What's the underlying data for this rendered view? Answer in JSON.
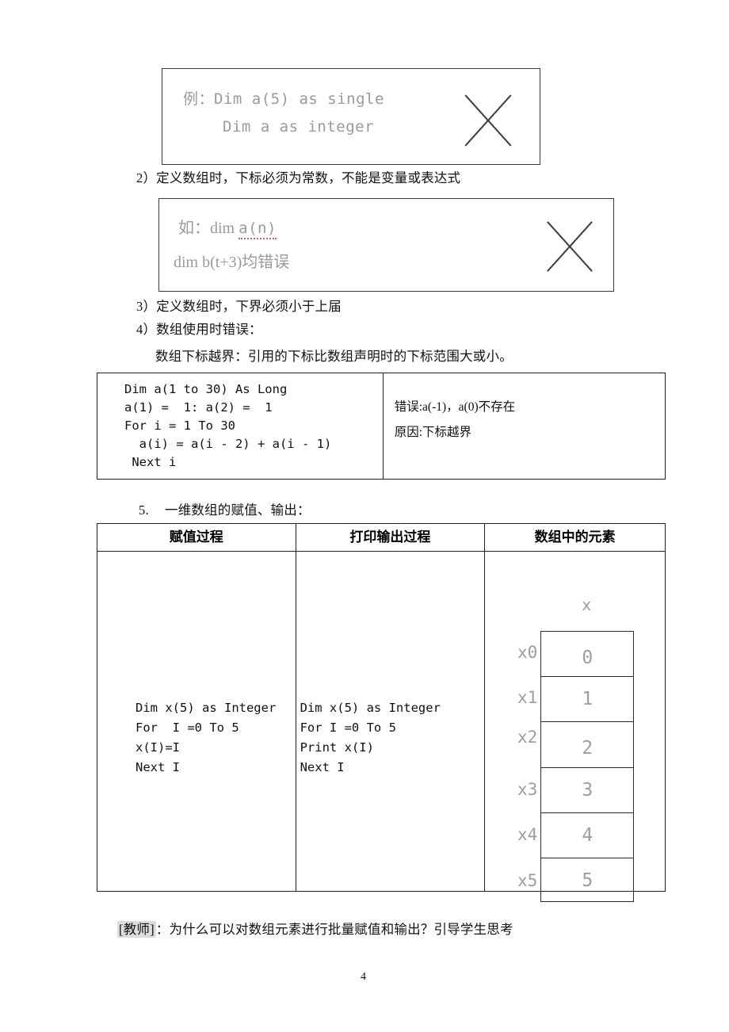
{
  "page": {
    "number": "4",
    "background": "#ffffff"
  },
  "example_box_1": {
    "lines": [
      "例：Dim a(5) as single",
      "Dim a as integer"
    ],
    "mark": "x-cross-mark"
  },
  "rule_2": "2）定义数组时，下标必须为常数，不能是变量或表达式",
  "example_box_2": {
    "line1_prefix": "如：dim ",
    "line1_squiggly": "a(n)",
    "line2": "dim b(t+3)均错误",
    "mark": "x-cross-mark"
  },
  "rule_3": "3）定义数组时，下界必须小于上届",
  "rule_4": "4）数组使用时错误：",
  "rule_4_detail": "数组下标越界：引用的下标比数组声明时的下标范围大或小。",
  "error_table": {
    "code": "Dim a(1 to 30) As Long\na(1) =  1: a(2) =  1\nFor i = 1 To 30\n  a(i) = a(i - 2) + a(i - 1)\n Next i",
    "note_line1": "错误:a(-1)，a(0)不存在",
    "note_line2": "原因:下标越界"
  },
  "section_5": {
    "number": "5.",
    "title": "一维数组的赋值、输出："
  },
  "main_table": {
    "headers": [
      "赋值过程",
      "打印输出过程",
      "数组中的元素"
    ],
    "assign_code": "Dim x(5) as Integer\nFor  I =0 To 5\nx(I)=I\nNext I",
    "print_code": "Dim x(5) as Integer\nFor I =0 To 5\nPrint x(I)\nNext I",
    "array_diagram": {
      "name": "x",
      "labels": [
        "x0",
        "x1",
        "x2",
        "x3",
        "x4",
        "x5"
      ],
      "values": [
        "0",
        "1",
        "2",
        "3",
        "4",
        "5"
      ]
    }
  },
  "teacher_note": {
    "tag": "[教师]",
    "text": "：为什么可以对数组元素进行批量赋值和输出？引导学生思考"
  }
}
